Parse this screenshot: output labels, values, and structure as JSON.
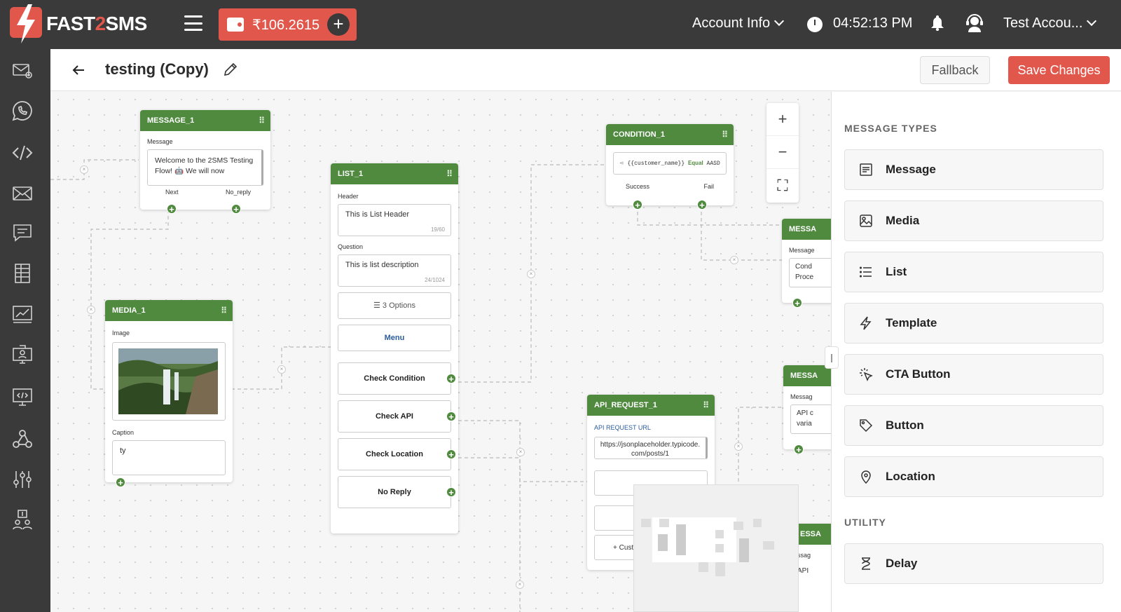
{
  "brand": {
    "logo_text_a": "FAST",
    "logo_text_b": "2",
    "logo_text_c": "SMS"
  },
  "topbar": {
    "wallet_balance": "₹106.2615",
    "account_info": "Account Info",
    "time": "04:52:13 PM",
    "user_name": "Test Accou..."
  },
  "header": {
    "title": "testing (Copy)",
    "fallback_label": "Fallback",
    "save_label": "Save Changes"
  },
  "nodes": {
    "message_1": {
      "title": "MESSAGE_1",
      "label": "Message",
      "text": "Welcome to the 2SMS Testing Flow! 🤖 We will now",
      "next": "Next",
      "no_reply": "No_reply"
    },
    "media_1": {
      "title": "MEDIA_1",
      "image_label": "Image",
      "caption_label": "Caption",
      "caption": "ty"
    },
    "list_1": {
      "title": "LIST_1",
      "header_label": "Header",
      "header_text": "This is List Header",
      "header_count": "19/60",
      "question_label": "Question",
      "question_text": "This is list description",
      "question_count": "24/1024",
      "options": "3 Options",
      "menu": "Menu",
      "buttons": [
        "Check Condition",
        "Check API",
        "Check Location",
        "No Reply"
      ]
    },
    "condition_1": {
      "title": "CONDITION_1",
      "var": "{{customer_name}}",
      "op": "Equal",
      "value": "AASD",
      "success": "Success",
      "fail": "Fail"
    },
    "api_request_1": {
      "title": "API_REQUEST_1",
      "url_label": "API REQUEST URL",
      "url": "https://jsonplaceholder.typicode.com/posts/1",
      "custom": "+ Cust"
    },
    "partial_1": {
      "title": "MESSA",
      "label": "Message",
      "line1": "Cond",
      "line2": "Proce"
    },
    "partial_2": {
      "title": "MESSA",
      "label": "Messag",
      "line1": "API c",
      "line2": "varia"
    },
    "partial_3": {
      "title": "ESSA",
      "label": "ssag",
      "line1": "API"
    }
  },
  "panel": {
    "section_message_types": "MESSAGE TYPES",
    "section_utility": "UTILITY",
    "items": [
      "Message",
      "Media",
      "List",
      "Template",
      "CTA Button",
      "Button",
      "Location"
    ],
    "utility_items": [
      "Delay"
    ]
  },
  "colors": {
    "topbar": "#3a3a3a",
    "accent": "#e2574c",
    "node_header": "#4f8a3f"
  },
  "icons": {
    "sidebar": [
      "mail-plus-icon",
      "whatsapp-icon",
      "code-icon",
      "mail-icon",
      "chat-icon",
      "sheet-icon",
      "chart-icon",
      "monitor-user-icon",
      "monitor-code-icon",
      "webhook-icon",
      "sliders-icon",
      "users-dollar-icon"
    ]
  }
}
